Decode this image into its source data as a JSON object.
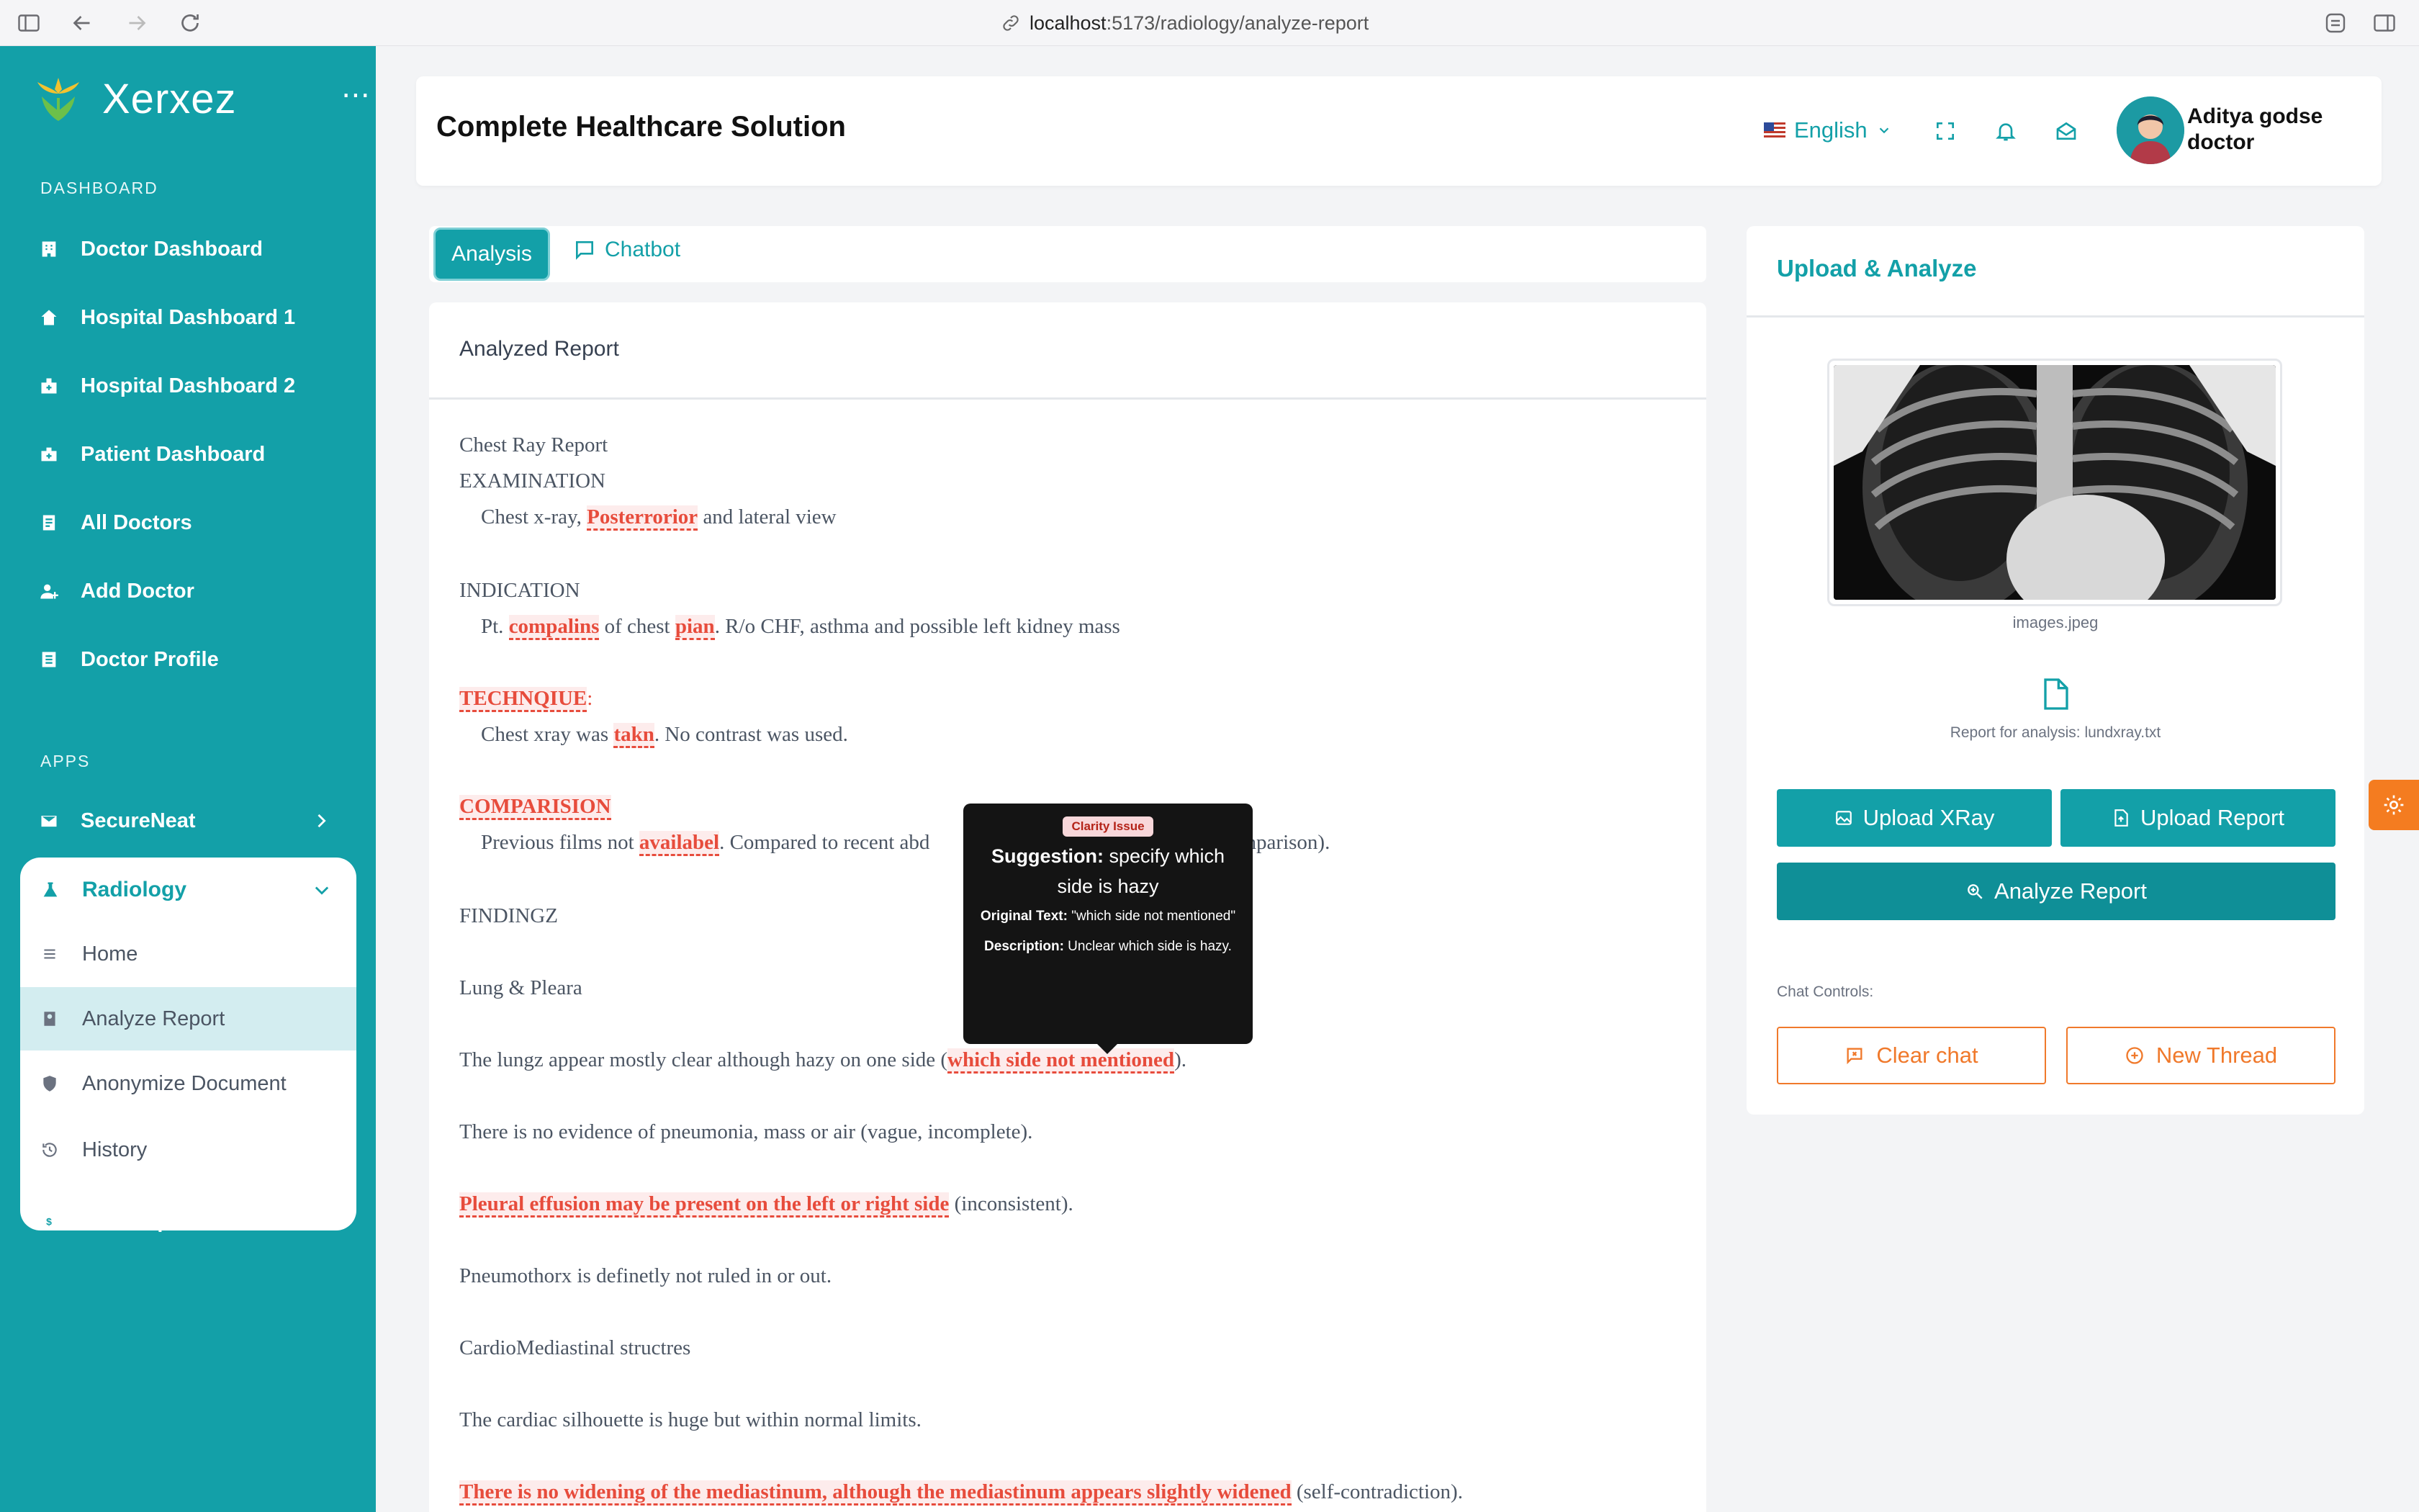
{
  "browser": {
    "url_host": "localhost",
    "url_path": ":5173/radiology/analyze-report"
  },
  "sidebar": {
    "brand": "Xerxez",
    "dashboard_label": "DASHBOARD",
    "apps_label": "APPS",
    "items": [
      {
        "label": "Doctor Dashboard",
        "icon": "building-icon"
      },
      {
        "label": "Hospital Dashboard 1",
        "icon": "home-icon"
      },
      {
        "label": "Hospital Dashboard 2",
        "icon": "hospital-icon"
      },
      {
        "label": "Patient Dashboard",
        "icon": "briefcase-icon"
      },
      {
        "label": "All Doctors",
        "icon": "list-icon"
      },
      {
        "label": "Add Doctor",
        "icon": "user-plus-icon"
      },
      {
        "label": "Doctor Profile",
        "icon": "profile-icon"
      }
    ],
    "apps": [
      {
        "label": "SecureNeat",
        "icon": "mail-icon"
      },
      {
        "label": "Radiology",
        "icon": "flask-icon"
      },
      {
        "label": "Subscriptions",
        "icon": "dollar-icon"
      }
    ],
    "radiology_sub": [
      {
        "label": "Home",
        "icon": "menu-icon"
      },
      {
        "label": "Analyze Report",
        "icon": "report-icon",
        "active": true
      },
      {
        "label": "Anonymize Document",
        "icon": "shield-icon"
      },
      {
        "label": "History",
        "icon": "history-icon"
      }
    ]
  },
  "header": {
    "title": "Complete Healthcare Solution",
    "language": "English",
    "user_name": "Aditya godse",
    "user_role": "doctor"
  },
  "tabs": {
    "analysis": "Analysis",
    "chatbot": "Chatbot"
  },
  "report": {
    "heading": "Analyzed Report",
    "lines": {
      "l1": "Chest Ray Report",
      "l2": "EXAMINATION",
      "l3a": "Chest x-ray, ",
      "l3b": "Posterrorior",
      "l3c": " and lateral view",
      "l4": "INDICATION",
      "l5a": "Pt. ",
      "l5b": "compalins",
      "l5c": " of chest ",
      "l5d": "pian",
      "l5e": ". R/o CHF, asthma and possible left kidney mass",
      "l6a": "TECHNQIUE",
      "l6b": ":",
      "l7a": "Chest xray was ",
      "l7b": "takn",
      "l7c": ". No contrast was used.",
      "l8": "COMPARISION",
      "l9a": "Previous films not ",
      "l9b": "availabel",
      "l9c": ". Compared to recent abd",
      "l9d": "omparison).",
      "l10": "FINDINGZ",
      "l11": "Lung & Pleara",
      "l12a": "The lungz appear mostly clear although hazy on one side (",
      "l12b": "which side not mentioned",
      "l12c": ").",
      "l13": "There is no evidence of pneumonia, mass or air (vague, incomplete).",
      "l14a": "Pleural effusion may be present on the left or right side",
      "l14b": " (inconsistent).",
      "l15": "Pneumothorx is definetly not ruled in or out.",
      "l16": "CardioMediastinal structres",
      "l17": "The cardiac silhouette is huge but within normal limits.",
      "l18a": "There is no widening of the mediastinum, although the mediastinum appears slightly widened",
      "l18b": " (self-contradiction)."
    }
  },
  "tooltip": {
    "badge": "Clarity Issue",
    "suggestion_label": "Suggestion:",
    "suggestion": " specify which side is hazy",
    "original_label": "Original Text:",
    "original": " \"which side not mentioned\"",
    "description_label": "Description:",
    "description": " Unclear which side is hazy."
  },
  "panel": {
    "title": "Upload & Analyze",
    "image_name": "images.jpeg",
    "report_name": "Report for analysis: lundxray.txt",
    "upload_xray": "Upload XRay",
    "upload_report": "Upload Report",
    "analyze": "Analyze Report",
    "chat_controls": "Chat Controls:",
    "clear_chat": "Clear chat",
    "new_thread": "New Thread"
  },
  "colors": {
    "brand_teal": "#13a0a8",
    "error_red": "#e74c3c",
    "accent_orange": "#f0792b"
  }
}
